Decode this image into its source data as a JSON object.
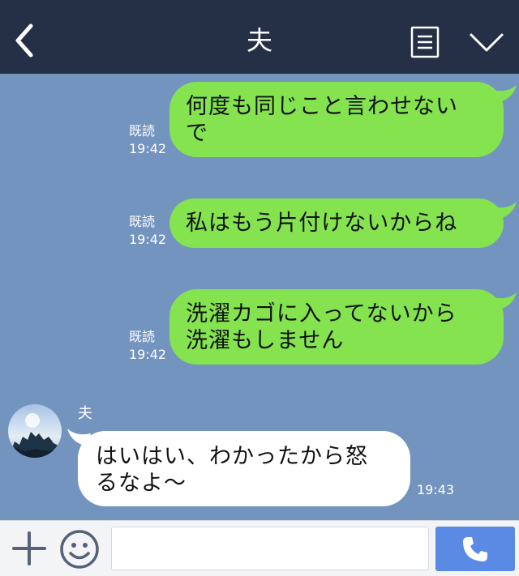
{
  "header": {
    "title": "夫",
    "back_icon": "chevron-left-icon",
    "menu_icon": "notes-list-icon",
    "collapse_icon": "chevron-down-icon"
  },
  "messages": [
    {
      "direction": "out",
      "lines": [
        "何度も同じこと言わせない",
        "で"
      ],
      "read": "既読",
      "time": "19:42"
    },
    {
      "direction": "out",
      "lines": [
        "私はもう片付けないからね"
      ],
      "read": "既読",
      "time": "19:42"
    },
    {
      "direction": "out",
      "lines": [
        "洗濯カゴに入ってないから",
        "洗濯もしません"
      ],
      "read": "既読",
      "time": "19:42"
    },
    {
      "direction": "in",
      "sender": "夫",
      "lines": [
        "はいはい、わかったから怒",
        "るなよ〜"
      ],
      "time": "19:43"
    }
  ],
  "composer": {
    "input_value": "",
    "plus_icon": "plus-icon",
    "emoji_icon": "smiley-icon",
    "call_icon": "phone-icon"
  },
  "colors": {
    "header_bg": "#253047",
    "chat_bg": "#7494c0",
    "outgoing_bubble": "#84e34f",
    "incoming_bubble": "#ffffff",
    "call_button": "#5a8ae4"
  }
}
